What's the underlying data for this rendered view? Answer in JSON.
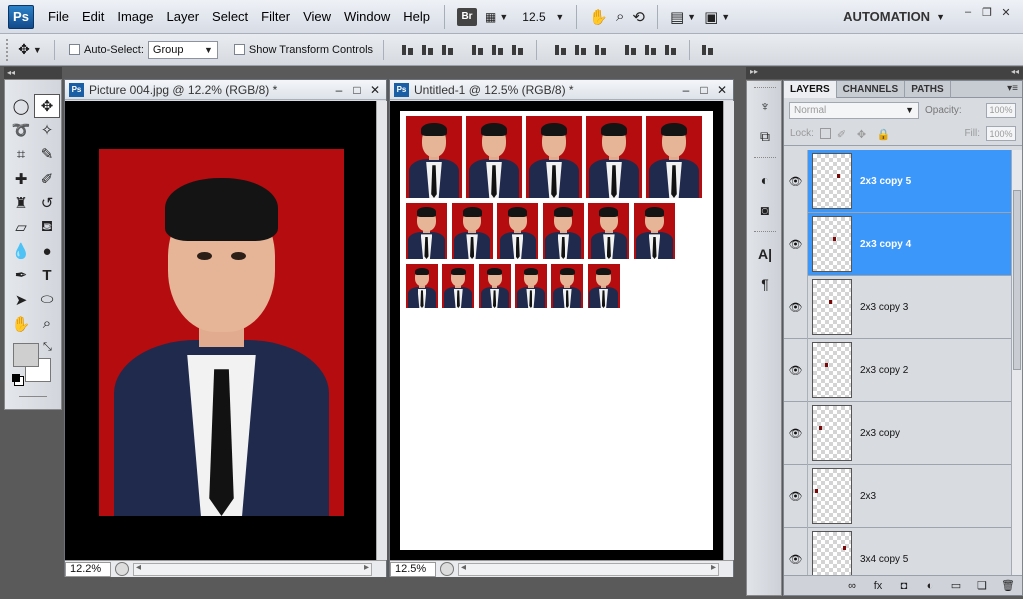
{
  "app": {
    "logo": "Ps",
    "menu": [
      "File",
      "Edit",
      "Image",
      "Layer",
      "Select",
      "Filter",
      "View",
      "Window",
      "Help"
    ],
    "bridge_badge": "Br",
    "zoom": "12.5",
    "workspace": "AUTOMATION",
    "window_controls": [
      "–",
      "❐",
      "✕"
    ]
  },
  "options": {
    "auto_select_label": "Auto-Select:",
    "auto_select_value": "Group",
    "show_transform_label": "Show Transform Controls"
  },
  "doc1": {
    "title": "Picture 004.jpg @ 12.2% (RGB/8) *",
    "zoom": "12.2%"
  },
  "doc2": {
    "title": "Untitled-1 @ 12.5% (RGB/8) *",
    "zoom": "12.5%"
  },
  "layers_panel": {
    "tabs": [
      "LAYERS",
      "CHANNELS",
      "PATHS"
    ],
    "blend_mode": "Normal",
    "opacity_label": "Opacity:",
    "opacity_value": "100%",
    "lock_label": "Lock:",
    "fill_label": "Fill:",
    "fill_value": "100%",
    "layers": [
      {
        "name": "2x3 copy 5",
        "selected": true
      },
      {
        "name": "2x3 copy 4",
        "selected": true
      },
      {
        "name": "2x3 copy 3",
        "selected": false
      },
      {
        "name": "2x3 copy 2",
        "selected": false
      },
      {
        "name": "2x3 copy",
        "selected": false
      },
      {
        "name": "2x3",
        "selected": false
      },
      {
        "name": "3x4 copy 5",
        "selected": false
      }
    ],
    "footer_icons": [
      "link-icon",
      "fx-icon",
      "mask-icon",
      "adjustment-icon",
      "group-icon",
      "new-layer-icon",
      "trash-icon"
    ],
    "footer_glyphs": [
      "∞",
      "fx",
      "◘",
      "◐",
      "▭",
      "❏",
      "🗑"
    ]
  },
  "colors": {
    "background_red": "#b40c0f",
    "selection_blue": "#3c97fa"
  }
}
